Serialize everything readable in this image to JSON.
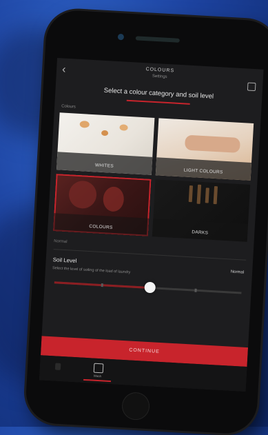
{
  "screen": {
    "nav": {
      "title": "COLOURS",
      "subtitle": "Settings"
    },
    "heading": "Select a colour category and soil level",
    "category_section_label": "Colours",
    "categories": [
      {
        "label": "WHITES"
      },
      {
        "label": "LIGHT COLOURS"
      },
      {
        "label": "COLOURS"
      },
      {
        "label": "DARKS"
      }
    ],
    "selected_category": "COLOURS",
    "soil": {
      "section_caption": "Normal",
      "title": "Soil Level",
      "description": "Select the level of soiling of the load of laundry",
      "value": "Normal",
      "level_fraction": 0.51
    },
    "continue_label": "CONTINUE",
    "tabbar": {
      "active_tab_label": "Wash"
    }
  },
  "colors": {
    "accent": "#c8242c",
    "screen_bg": "#1d1d1f",
    "background": "#1d43a0"
  },
  "icons": {
    "back": "chevron-left-icon",
    "info": "info-icon",
    "tab": "laundry-icon"
  }
}
